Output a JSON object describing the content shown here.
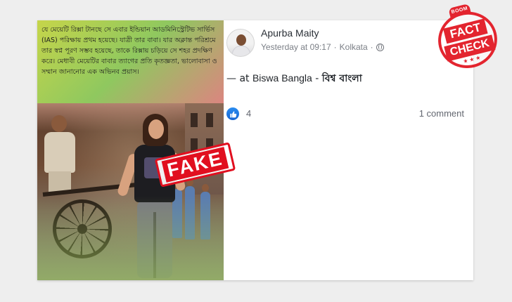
{
  "post_image": {
    "caption": "যে মেয়েটি রিক্সা টানছে সে এবার ইন্ডিয়ান আডমিনিস্ট্রেটিভ সার্ভিস (IAS) পরিক্ষায় প্রথম হয়েছে। যাত্রী তার বাবা। যার অক্লান্ত পরিশ্রমে তার স্বপ্ন পূরণ সম্ভব হয়েছে, তাকে রিক্সায় চড়িয়ে সে শহর প্রদক্ষিণ করে। মেধাবী মেয়েটির বাবার ত্যাগের প্রতি কৃতজ্ঞতা, ভালোবাসা ও সম্মান জানানোর এক অভিনব প্রয়াস।",
    "stamp": "FAKE"
  },
  "post": {
    "author": "Apurba Maity",
    "time": "Yesterday at 09:17",
    "location": "Kolkata",
    "separator": "·",
    "checkin_prefix": "— at ",
    "place_en": "Biswa Bangla",
    "place_dash": " - ",
    "place_bn": "বিশ্ব বাংলা",
    "likes": "4",
    "comments": "1 comment"
  },
  "badge": {
    "top": "BOOM",
    "line1": "FACT",
    "line2": "CHECK",
    "stars": "★★★",
    "color": "#e3252f"
  },
  "icons": [
    "like-icon",
    "globe-icon",
    "avatar"
  ],
  "colors": {
    "fake": "#e10f1f",
    "like": "#1877f2"
  }
}
